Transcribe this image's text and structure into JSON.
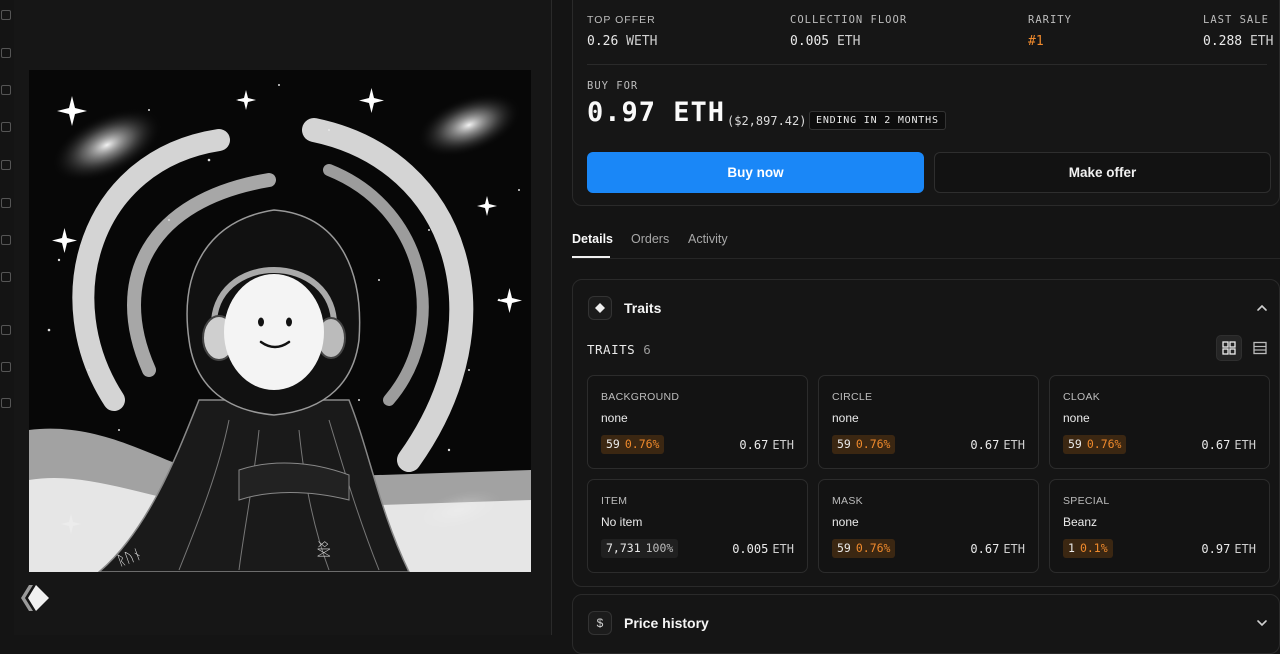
{
  "stats": {
    "top_offer": {
      "label": "TOP OFFER",
      "value": "0.26",
      "unit": "WETH"
    },
    "collection_floor": {
      "label": "COLLECTION FLOOR",
      "value": "0.005",
      "unit": "ETH"
    },
    "rarity": {
      "label": "RARITY",
      "value": "#1"
    },
    "last_sale": {
      "label": "LAST SALE",
      "value": "0.288",
      "unit": "ETH"
    }
  },
  "buy": {
    "label": "BUY FOR",
    "price": "0.97 ETH",
    "usd": "($2,897.42)",
    "ending": "ENDING IN 2 MONTHS",
    "buy_button": "Buy now",
    "offer_button": "Make offer"
  },
  "tabs": [
    {
      "label": "Details",
      "active": true
    },
    {
      "label": "Orders",
      "active": false
    },
    {
      "label": "Activity",
      "active": false
    }
  ],
  "traits_section": {
    "title": "Traits",
    "count_label": "TRAITS",
    "count": "6",
    "items": [
      {
        "label": "BACKGROUND",
        "value": "none",
        "count": "59",
        "pct": "0.76%",
        "price": "0.67",
        "unit": "ETH",
        "highlight": true
      },
      {
        "label": "CIRCLE",
        "value": "none",
        "count": "59",
        "pct": "0.76%",
        "price": "0.67",
        "unit": "ETH",
        "highlight": true
      },
      {
        "label": "CLOAK",
        "value": "none",
        "count": "59",
        "pct": "0.76%",
        "price": "0.67",
        "unit": "ETH",
        "highlight": true
      },
      {
        "label": "ITEM",
        "value": "No item",
        "count": "7,731",
        "pct": "100%",
        "price": "0.005",
        "unit": "ETH",
        "highlight": false
      },
      {
        "label": "MASK",
        "value": "none",
        "count": "59",
        "pct": "0.76%",
        "price": "0.67",
        "unit": "ETH",
        "highlight": true
      },
      {
        "label": "SPECIAL",
        "value": "Beanz",
        "count": "1",
        "pct": "0.1%",
        "price": "0.97",
        "unit": "ETH",
        "highlight": true
      }
    ]
  },
  "price_history": {
    "title": "Price history",
    "icon_text": "$"
  },
  "colors": {
    "accent": "#1a87f7",
    "rarity": "#f08a2c",
    "background": "#141414"
  }
}
